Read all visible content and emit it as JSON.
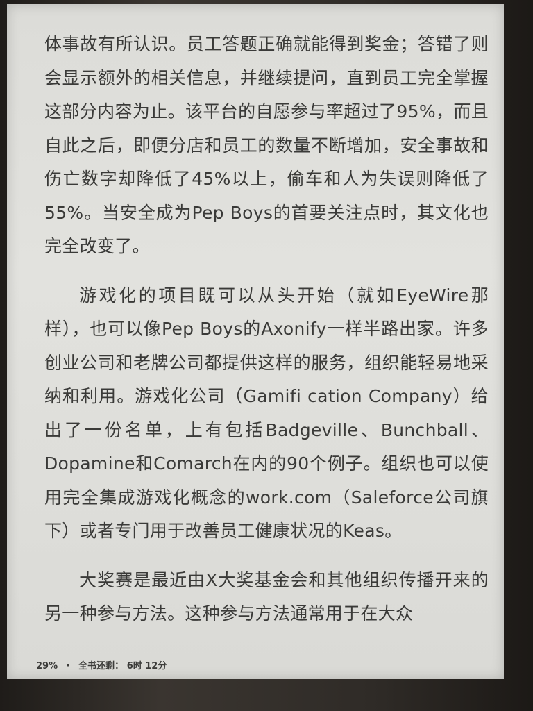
{
  "reader": {
    "paragraphs": [
      {
        "text": "体事故有所认识。员工答题正确就能得到奖金；答错了则会显示额外的相关信息，并继续提问，直到员工完全掌握这部分内容为止。该平台的自愿参与率超过了95%，而且自此之后，即便分店和员工的数量不断增加，安全事故和伤亡数字却降低了45%以上，偷车和人为失误则降低了55%。当安全成为Pep Boys的首要关注点时，其文化也完全改变了。",
        "indent": false
      },
      {
        "text": "游戏化的项目既可以从头开始（就如EyeWire那样），也可以像Pep Boys的Axonify一样半路出家。许多创业公司和老牌公司都提供这样的服务，组织能轻易地采纳和利用。游戏化公司（Gamifi cation Company）给出了一份名单，上有包括Badgeville、Bunchball、Dopamine和Comarch在内的90个例子。组织也可以使用完全集成游戏化概念的work.com（Saleforce公司旗下）或者专门用于改善员工健康状况的Keas。",
        "indent": true
      },
      {
        "text": "大奖赛是最近由X大奖基金会和其他组织传播开来的另一种参与方法。这种参与方法通常用于在大众",
        "indent": true
      }
    ]
  },
  "status": {
    "progress": "29%",
    "separator": "·",
    "remaining_label": "全书还剩：",
    "remaining_time": "6时 12分"
  }
}
